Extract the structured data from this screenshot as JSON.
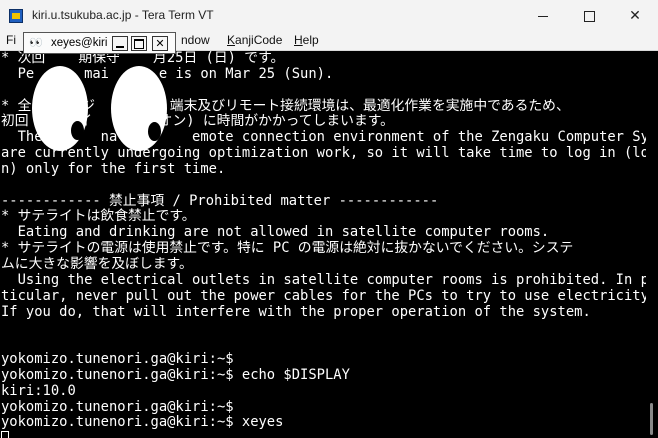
{
  "window": {
    "title": "kiri.u.tsukuba.ac.jp - Tera Term VT",
    "icon": "tera-term-icon",
    "minimize_glyph": "",
    "close_glyph": "✕"
  },
  "menu": {
    "items": [
      {
        "label": "Fi",
        "underline": ""
      },
      {
        "label": "ndow",
        "underline": ""
      },
      {
        "label": "KanjiCode",
        "underline": "K"
      },
      {
        "label": "Help",
        "underline": "H"
      }
    ]
  },
  "terminal": {
    "lines": [
      "* 次回    期保守    月25日 (日) です。",
      "  Pe      mai      e is on Mar 25 (Sun).",
      "",
      "* 全      ジ         端末及びリモート接続環境は、最適化作業を実施中であるため、",
      "初回      イ        オン) に時間がかかってしまいます。",
      "  The       nal        emote connection environment of the Zengaku Computer System",
      "are currently undergoing optimization work, so it will take time to log in (logo",
      "n) only for the first time.",
      "",
      "------------ 禁止事項 / Prohibited matter ------------",
      "* サテライトは飲食禁止です。",
      "  Eating and drinking are not allowed in satellite computer rooms.",
      "* サテライトの電源は使用禁止です。特に PC の電源は絶対に抜かないでください。システ",
      "ムに大きな影響を及ぼします。",
      "  Using the electrical outlets in satellite computer rooms is prohibited. In par",
      "ticular, never pull out the power cables for the PCs to try to use electricity.",
      "If you do, that will interfere with the proper operation of the system.",
      "",
      "",
      "yokomizo.tunenori.ga@kiri:~$",
      "yokomizo.tunenori.ga@kiri:~$ echo $DISPLAY",
      "kiri:10.0",
      "yokomizo.tunenori.ga@kiri:~$",
      "yokomizo.tunenori.ga@kiri:~$ xeyes"
    ]
  },
  "xeyes": {
    "title": "xeyes@kiri",
    "icon_glyph": "👀",
    "close_glyph": "✕"
  }
}
